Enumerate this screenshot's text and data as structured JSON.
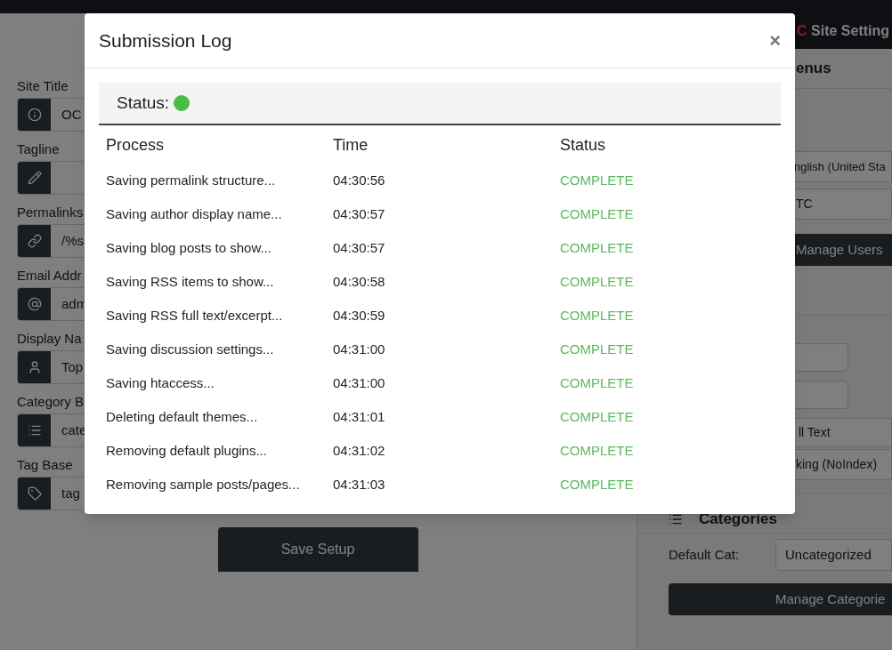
{
  "form": {
    "fields": [
      {
        "label": "Site Title",
        "value": "OC"
      },
      {
        "label": "Tagline"
      },
      {
        "label": "Permalinks",
        "value": "/%s"
      },
      {
        "label": "Email Addr",
        "value": "adm"
      },
      {
        "label": "Display Na",
        "value": "Top"
      },
      {
        "label": "Category B",
        "value": "cate"
      },
      {
        "label": "Tag Base",
        "value": "tag"
      }
    ],
    "save_button": "Save Setup"
  },
  "sidebar": {
    "title_accent": "C",
    "title": "Site Setting",
    "menus_heading": "enus",
    "language": "nglish (United Sta",
    "timezone": "TC",
    "manage_users": "Manage Users",
    "excerpt": "ll Text",
    "indexing": "king (NoIndex)",
    "categories_heading": "Categories",
    "default_cat_label": "Default Cat:",
    "default_cat": "Uncategorized",
    "manage_categories": "Manage Categorie"
  },
  "modal": {
    "title": "Submission Log",
    "close": "×",
    "status": {
      "label": "Status:",
      "color": "#4cbb47"
    },
    "columns": [
      "Process",
      "Time",
      "Status"
    ],
    "rows": [
      {
        "process": "Saving permalink structure...",
        "time": "04:30:56",
        "status": "COMPLETE"
      },
      {
        "process": "Saving author display name...",
        "time": "04:30:57",
        "status": "COMPLETE"
      },
      {
        "process": "Saving blog posts to show...",
        "time": "04:30:57",
        "status": "COMPLETE"
      },
      {
        "process": "Saving RSS items to show...",
        "time": "04:30:58",
        "status": "COMPLETE"
      },
      {
        "process": "Saving RSS full text/excerpt...",
        "time": "04:30:59",
        "status": "COMPLETE"
      },
      {
        "process": "Saving discussion settings...",
        "time": "04:31:00",
        "status": "COMPLETE"
      },
      {
        "process": "Saving htaccess...",
        "time": "04:31:00",
        "status": "COMPLETE"
      },
      {
        "process": "Deleting default themes...",
        "time": "04:31:01",
        "status": "COMPLETE"
      },
      {
        "process": "Removing default plugins...",
        "time": "04:31:02",
        "status": "COMPLETE"
      },
      {
        "process": "Removing sample posts/pages...",
        "time": "04:31:03",
        "status": "COMPLETE"
      }
    ]
  }
}
